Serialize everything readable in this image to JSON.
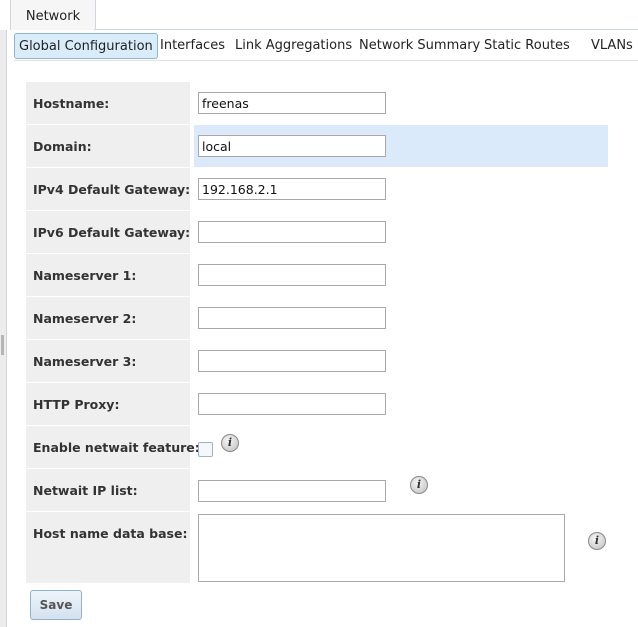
{
  "top_tab": {
    "label": "Network"
  },
  "subtabs": [
    {
      "label": "Global Configuration",
      "active": true
    },
    {
      "label": "Interfaces"
    },
    {
      "label": "Link Aggregations"
    },
    {
      "label": "Network Summary"
    },
    {
      "label": "Static Routes"
    },
    {
      "label": "VLANs"
    }
  ],
  "form": {
    "hostname": {
      "label": "Hostname:",
      "value": "freenas"
    },
    "domain": {
      "label": "Domain:",
      "value": "local"
    },
    "ipv4_gateway": {
      "label": "IPv4 Default Gateway:",
      "value": "192.168.2.1"
    },
    "ipv6_gateway": {
      "label": "IPv6 Default Gateway:",
      "value": ""
    },
    "nameserver1": {
      "label": "Nameserver 1:",
      "value": ""
    },
    "nameserver2": {
      "label": "Nameserver 2:",
      "value": ""
    },
    "nameserver3": {
      "label": "Nameserver 3:",
      "value": ""
    },
    "http_proxy": {
      "label": "HTTP Proxy:",
      "value": ""
    },
    "netwait_enable": {
      "label": "Enable netwait feature:",
      "checked": false
    },
    "netwait_ip_list": {
      "label": "Netwait IP list:",
      "value": ""
    },
    "host_db": {
      "label": "Host name data base:",
      "value": ""
    }
  },
  "info_icon_glyph": "i",
  "save_label": "Save",
  "colors": {
    "highlight_row": "#dbeafa",
    "label_bg": "#efefef",
    "active_tab_bg": "#d9ecf9"
  }
}
